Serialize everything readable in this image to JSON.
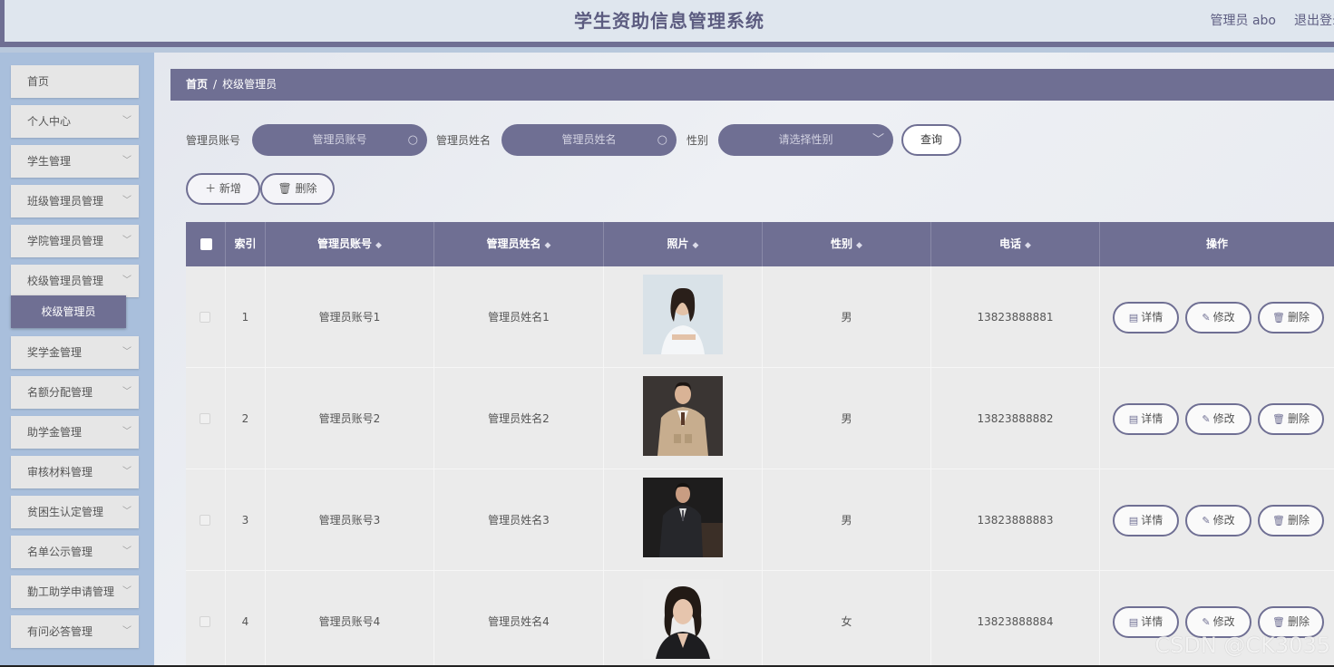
{
  "header": {
    "title": "学生资助信息管理系统",
    "user": "管理员 abo",
    "logout": "退出登录"
  },
  "sidebar": {
    "items": [
      {
        "label": "首页",
        "chevron": false
      },
      {
        "label": "个人中心",
        "chevron": true
      },
      {
        "label": "学生管理",
        "chevron": true
      },
      {
        "label": "班级管理员管理",
        "chevron": true
      },
      {
        "label": "学院管理员管理",
        "chevron": true
      },
      {
        "label": "校级管理员管理",
        "chevron": true
      },
      {
        "label": "奖学金管理",
        "chevron": true
      },
      {
        "label": "名额分配管理",
        "chevron": true
      },
      {
        "label": "助学金管理",
        "chevron": true
      },
      {
        "label": "审核材料管理",
        "chevron": true
      },
      {
        "label": "贫困生认定管理",
        "chevron": true
      },
      {
        "label": "名单公示管理",
        "chevron": true
      },
      {
        "label": "勤工助学申请管理",
        "chevron": true
      },
      {
        "label": "有问必答管理",
        "chevron": true
      }
    ],
    "active_sub": "校级管理员"
  },
  "breadcrumb": {
    "home": "首页",
    "separator": "/",
    "current": "校级管理员"
  },
  "search": {
    "account_label": "管理员账号",
    "account_placeholder": "管理员账号",
    "name_label": "管理员姓名",
    "name_placeholder": "管理员姓名",
    "gender_label": "性别",
    "gender_placeholder": "请选择性别",
    "query_label": "查询"
  },
  "actions": {
    "add_label": "新增",
    "delete_label": "删除"
  },
  "table": {
    "headers": [
      "索引",
      "管理员账号",
      "管理员姓名",
      "照片",
      "性别",
      "电话",
      "操作"
    ],
    "rows": [
      {
        "index": "1",
        "account": "管理员账号1",
        "name": "管理员姓名1",
        "gender": "男",
        "phone": "13823888881"
      },
      {
        "index": "2",
        "account": "管理员账号2",
        "name": "管理员姓名2",
        "gender": "男",
        "phone": "13823888882"
      },
      {
        "index": "3",
        "account": "管理员账号3",
        "name": "管理员姓名3",
        "gender": "男",
        "phone": "13823888883"
      },
      {
        "index": "4",
        "account": "管理员账号4",
        "name": "管理员姓名4",
        "gender": "女",
        "phone": "13823888884"
      }
    ],
    "row_actions": {
      "detail": "详情",
      "edit": "修改",
      "delete": "删除"
    }
  },
  "watermark": "CSDN @CK3035",
  "colors": {
    "accent": "#6f6f93",
    "sidebar_bg": "#a9bfdc",
    "header_bg": "#dfe6ee"
  }
}
